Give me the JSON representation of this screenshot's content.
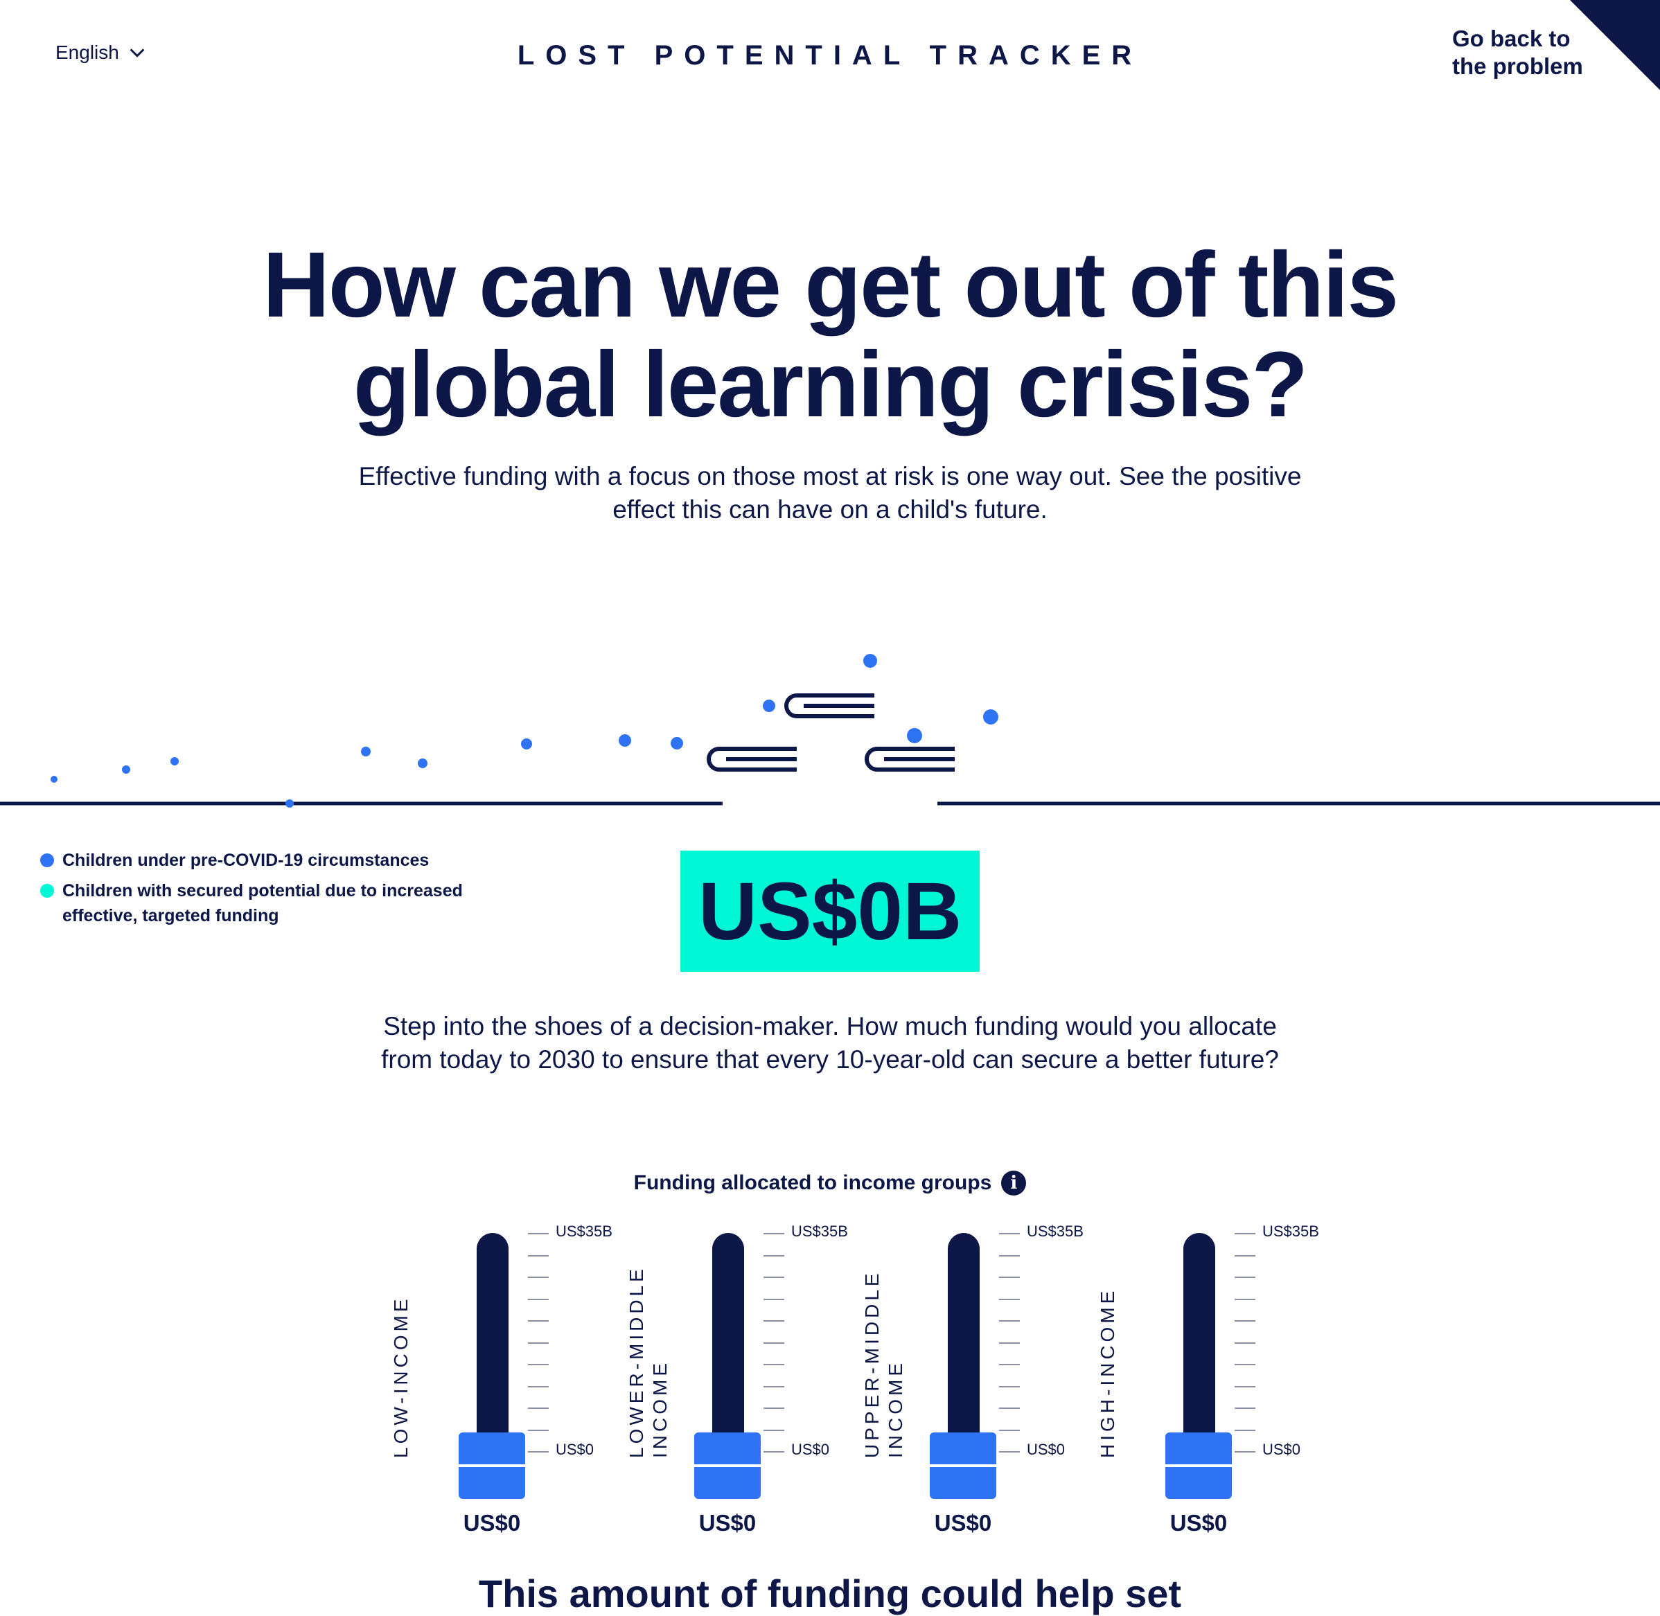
{
  "header": {
    "language": "English",
    "site_title": "LOST POTENTIAL TRACKER",
    "back_link": "Go back to the problem"
  },
  "hero": {
    "title_line1": "How can we get out of this",
    "title_line2": "global learning crisis?",
    "intro": "Effective funding with a focus on those most at risk is one way out. See the positive effect this can have on a child's future."
  },
  "legend": [
    {
      "label": "Children under pre-COVID-19 circumstances",
      "color": "#2f73f5"
    },
    {
      "label": "Children with secured potential due to increased effective, targeted funding",
      "color": "#00f7d5"
    }
  ],
  "total": "US$0B",
  "prompt": "Step into the shoes of a decision-maker. How much funding would you allocate from today to 2030 to ensure that every 10-year-old can secure a better future?",
  "funding": {
    "title": "Funding allocated to income groups",
    "info_icon": "info-icon",
    "max_label": "US$35B",
    "min_label": "US$0",
    "groups": [
      {
        "label": "LOW-INCOME",
        "value": 0,
        "amount": "US$0"
      },
      {
        "label": "LOWER-MIDDLE INCOME",
        "value": 0,
        "amount": "US$0"
      },
      {
        "label": "UPPER-MIDDLE INCOME",
        "value": 0,
        "amount": "US$0"
      },
      {
        "label": "HIGH-INCOME",
        "value": 0,
        "amount": "US$0"
      }
    ]
  },
  "bottom_text": "This amount of funding could help set",
  "colors": {
    "navy": "#0c1747",
    "blue": "#2f73f5",
    "teal": "#00f7d5"
  }
}
